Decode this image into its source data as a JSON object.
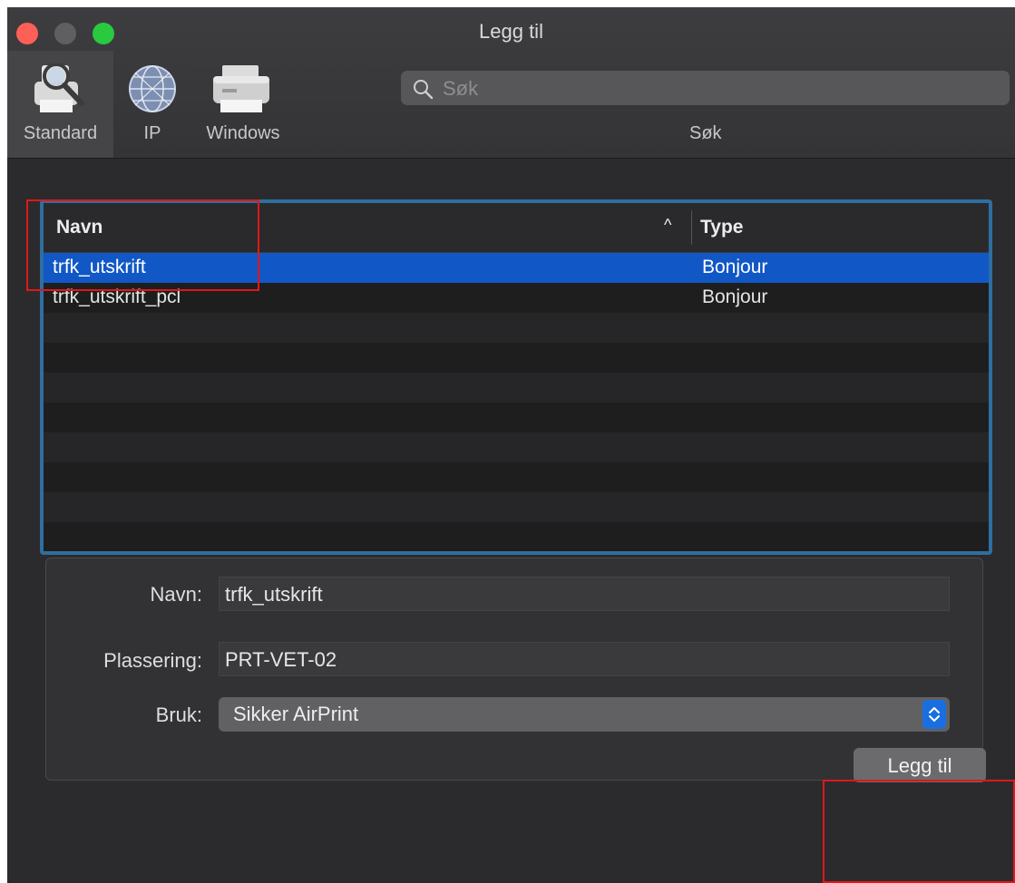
{
  "window": {
    "title": "Legg til"
  },
  "toolbar": {
    "buttons": [
      {
        "label": "Standard",
        "icon": "default-printer-icon"
      },
      {
        "label": "IP",
        "icon": "globe-icon"
      },
      {
        "label": "Windows",
        "icon": "windows-printer-icon"
      }
    ],
    "search_placeholder": "Søk",
    "search_caption": "Søk"
  },
  "table": {
    "columns": [
      "Navn",
      "Type"
    ],
    "sort_indicator": "^",
    "rows": [
      {
        "name": "trfk_utskrift",
        "type": "Bonjour",
        "selected": true
      },
      {
        "name": "trfk_utskrift_pcl",
        "type": "Bonjour",
        "selected": false
      }
    ]
  },
  "form": {
    "name_label": "Navn:",
    "name_value": "trfk_utskrift",
    "location_label": "Plassering:",
    "location_value": "PRT-VET-02",
    "use_label": "Bruk:",
    "use_value": "Sikker AirPrint"
  },
  "actions": {
    "add_label": "Legg til"
  },
  "colors": {
    "selection": "#1158c6",
    "focus_ring": "#2f6ea0",
    "annotation": "#e01818"
  }
}
